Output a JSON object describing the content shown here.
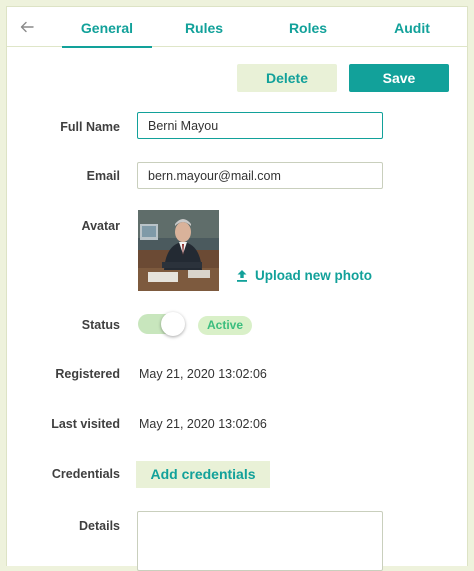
{
  "tabs": [
    {
      "label": "General",
      "active": true
    },
    {
      "label": "Rules"
    },
    {
      "label": "Roles"
    },
    {
      "label": "Audit"
    }
  ],
  "actions": {
    "delete_label": "Delete",
    "save_label": "Save"
  },
  "form": {
    "full_name_label": "Full Name",
    "full_name_value": "Berni Mayou",
    "email_label": "Email",
    "email_value": "bern.mayour@mail.com",
    "avatar_label": "Avatar",
    "upload_label": "Upload new photo",
    "status_label": "Status",
    "status_value": "Active",
    "status_on": true,
    "registered_label": "Registered",
    "registered_value": "May 21, 2020 13:02:06",
    "last_visited_label": "Last visited",
    "last_visited_value": "May 21, 2020 13:02:06",
    "credentials_label": "Credentials",
    "add_credentials_label": "Add credentials",
    "details_label": "Details",
    "details_value": ""
  },
  "colors": {
    "accent": "#12a19a",
    "page_background": "#eef2dc",
    "secondary_button": "#e9f1d7",
    "status_badge_text": "#3bbd7e"
  },
  "icons": {
    "back": "arrow-left-icon",
    "upload": "upload-icon"
  }
}
